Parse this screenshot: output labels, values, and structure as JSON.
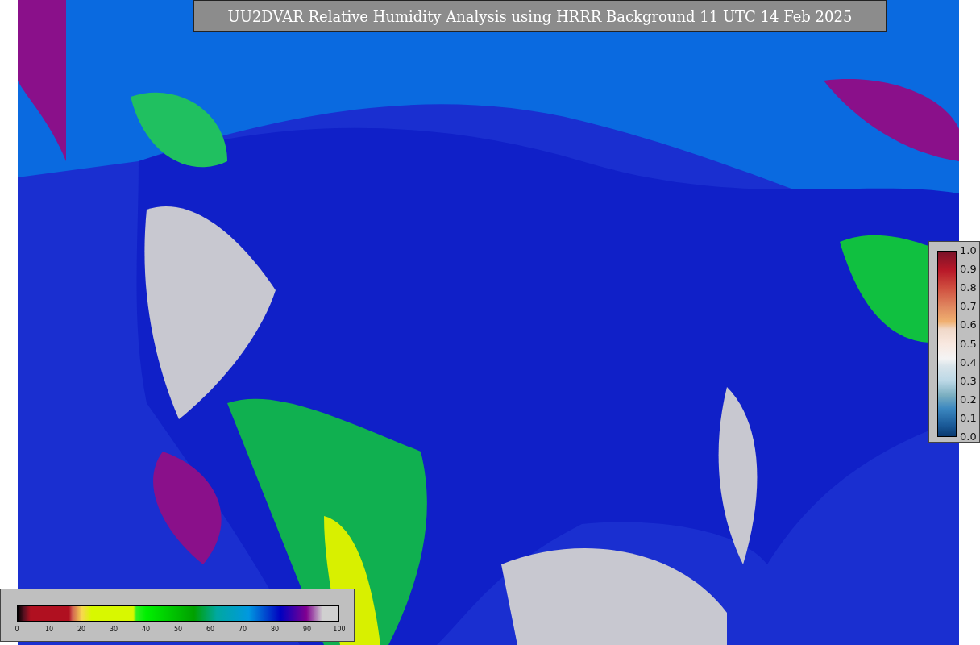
{
  "title": "UU2DVAR Relative Humidity Analysis using HRRR Background 11 UTC 14 Feb 2025",
  "humidity_colorbar": {
    "ticks": [
      "0",
      "10",
      "20",
      "30",
      "40",
      "50",
      "60",
      "70",
      "80",
      "90",
      "100"
    ]
  },
  "innovation_colorbar": {
    "ticks": [
      "1.0",
      "0.9",
      "0.8",
      "0.7",
      "0.6",
      "0.5",
      "0.4",
      "0.3",
      "0.2",
      "0.1",
      "0.0"
    ]
  }
}
